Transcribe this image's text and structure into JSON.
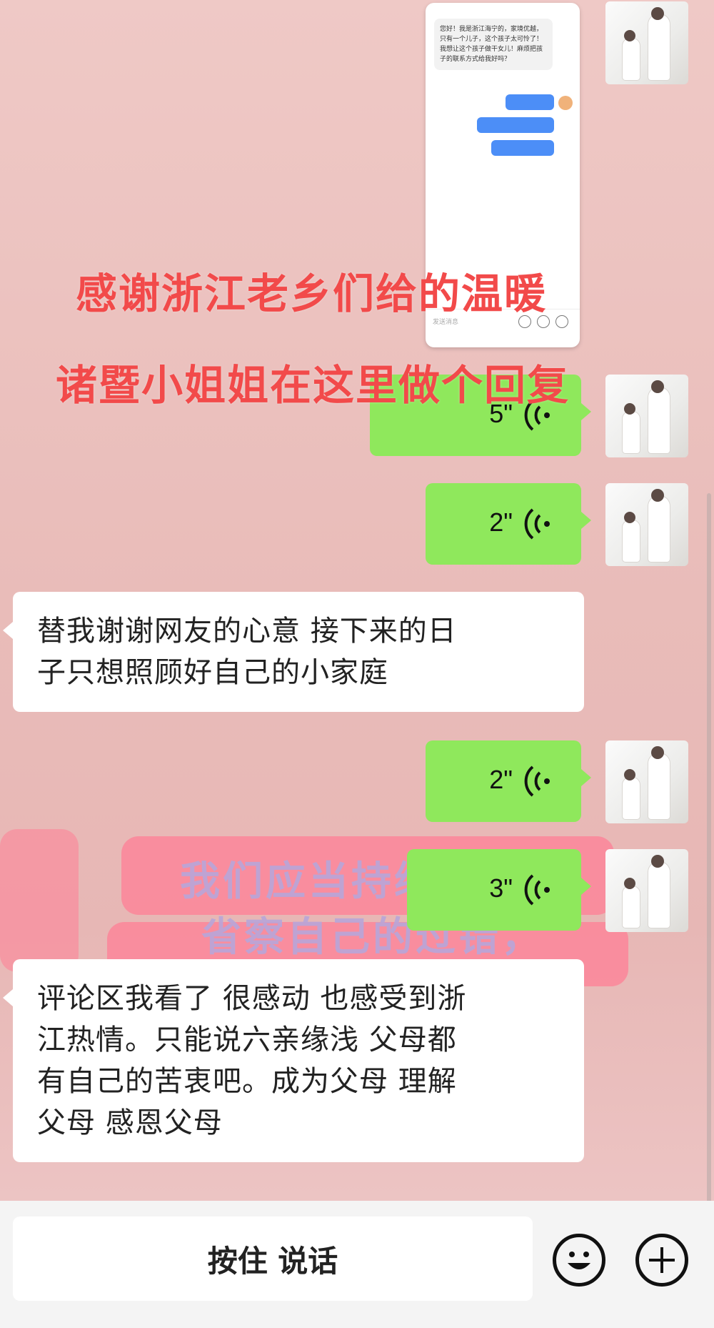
{
  "overlay": {
    "line1": "感谢浙江老乡们给的温暖",
    "line2": "诸暨小姐姐在这里做个回复"
  },
  "background_text": {
    "line1": "我们应当持续",
    "line2": "省察自己的过错，"
  },
  "embedded_screenshot": {
    "incoming_text": "您好！我是浙江海宁的，家境优越，只有一个儿子，这个孩子太可怜了！我想让这个孩子做干女儿！麻烦把孩子的联系方式给我好吗？",
    "input_hint": "发送消息"
  },
  "chat": {
    "voice_messages": [
      {
        "duration": "5\""
      },
      {
        "duration": "2\""
      },
      {
        "duration": "2\""
      },
      {
        "duration": "3\""
      }
    ],
    "text_messages": [
      {
        "lines": [
          "替我谢谢网友的心意  接下来的日",
          "子只想照顾好自己的小家庭"
        ]
      },
      {
        "lines": [
          "评论区我看了  很感动  也感受到浙",
          "江热情。只能说六亲缘浅    父母都",
          "有自己的苦衷吧。成为父母  理解",
          "父母  感恩父母"
        ]
      }
    ]
  },
  "input_bar": {
    "hold_to_talk": "按住 说话",
    "emoji_icon": "emoji-icon",
    "plus_icon": "plus-icon"
  },
  "colors": {
    "voice_bubble": "#8fe85c",
    "overlay_text": "#f24a4a",
    "background": "#e9bcb9"
  }
}
